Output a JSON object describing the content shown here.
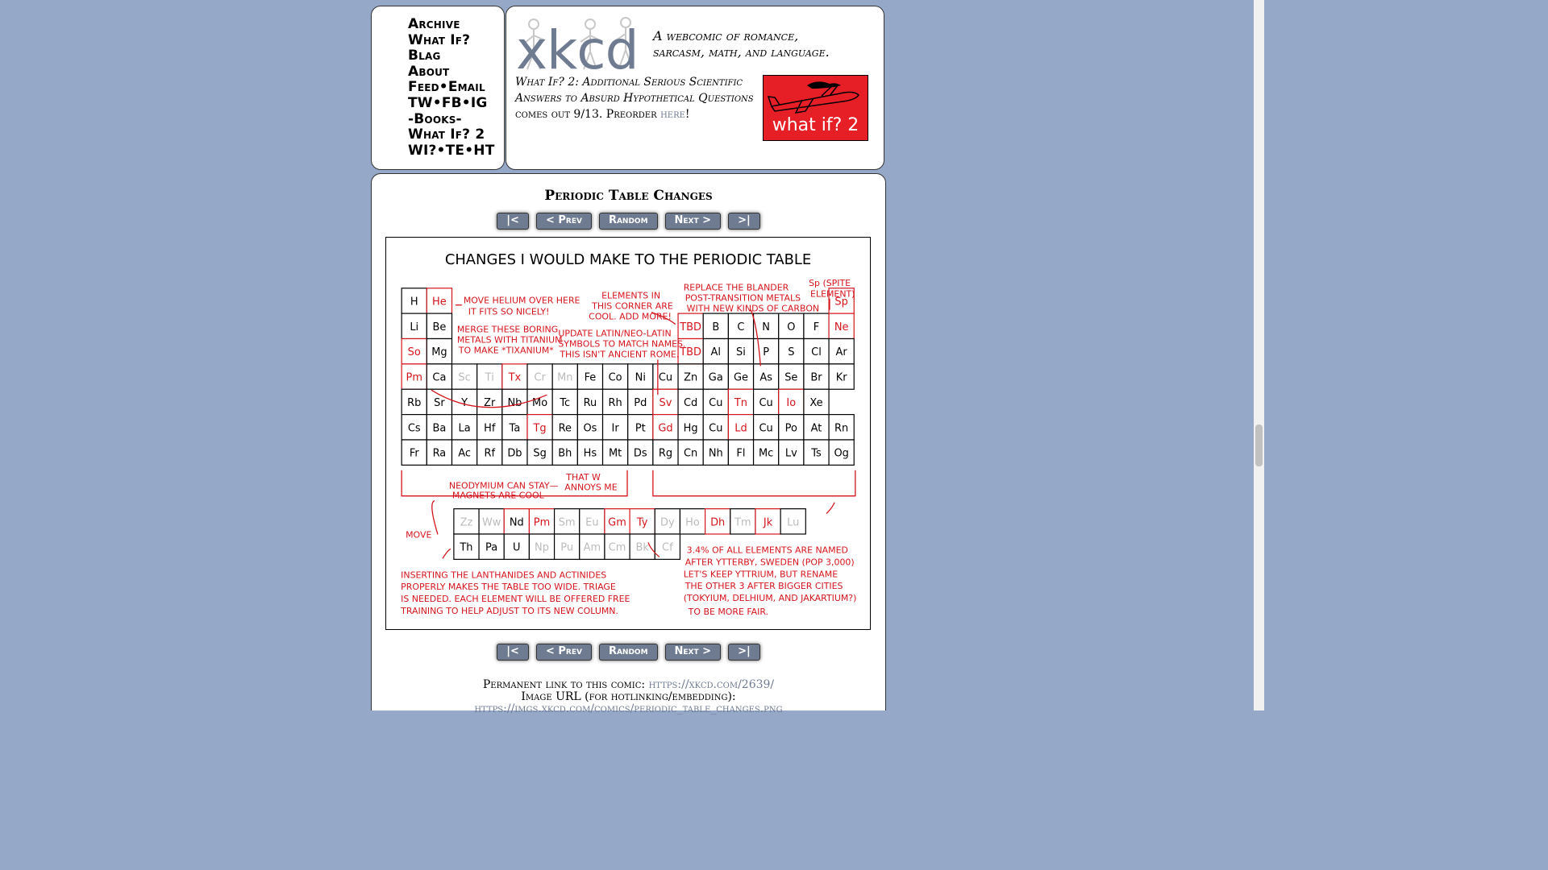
{
  "nav": {
    "items": [
      "Archive",
      "What If?",
      "Blag",
      "About",
      "Feed•Email",
      "TW•FB•IG",
      "-Books-",
      "What If? 2",
      "WI?•TE•HT"
    ]
  },
  "header": {
    "logo_text": "xkcd",
    "tagline_line1": "A webcomic of romance,",
    "tagline_line2": "sarcasm, math, and language.",
    "news_italic": "What If? 2: Additional Serious Scientific Answers to Absurd Hypothetical Questions",
    "news_rest": " comes out 9/13. Preorder ",
    "news_link": "here",
    "news_end": "!",
    "promo_label": "what if? 2"
  },
  "comic": {
    "title": "Periodic Table Changes",
    "buttons": {
      "first": "|<",
      "prev": "< Prev",
      "random": "Random",
      "next": "Next >",
      "last": ">|"
    },
    "panel_title": "CHANGES I WOULD MAKE TO THE PERIODIC TABLE",
    "table_rows": [
      [
        "H",
        "He",
        "",
        "",
        "",
        "",
        "",
        "",
        "",
        "",
        "",
        "",
        "",
        "",
        "",
        "",
        "",
        "Sp"
      ],
      [
        "Li",
        "Be",
        "",
        "",
        "",
        "",
        "",
        "",
        "",
        "",
        "",
        "",
        "TBD",
        "B",
        "C",
        "N",
        "O",
        "F",
        "Ne"
      ],
      [
        "So",
        "Mg",
        "",
        "",
        "",
        "",
        "",
        "",
        "",
        "",
        "",
        "",
        "TBD",
        "Al",
        "Si",
        "P",
        "S",
        "Cl",
        "Ar"
      ],
      [
        "Pm",
        "Ca",
        "Sc",
        "Ti",
        "Tx",
        "Cr",
        "Mn",
        "Fe",
        "Co",
        "Ni",
        "Cu",
        "Zn",
        "Ga",
        "Ge",
        "As",
        "Se",
        "Br",
        "Kr"
      ],
      [
        "Rb",
        "Sr",
        "Y",
        "Zr",
        "Nb",
        "Mo",
        "Tc",
        "Ru",
        "Rh",
        "Pd",
        "Sv",
        "Cd",
        "Cu",
        "Tn",
        "Cu",
        "Io",
        "Xe"
      ],
      [
        "Cs",
        "Ba",
        "La",
        "Hf",
        "Ta",
        "Tg",
        "Re",
        "Os",
        "Ir",
        "Pt",
        "Gd",
        "Hg",
        "Cu",
        "Ld",
        "Cu",
        "Po",
        "At",
        "Rn"
      ],
      [
        "Fr",
        "Ra",
        "Ac",
        "Rf",
        "Db",
        "Sg",
        "Bh",
        "Hs",
        "Mt",
        "Ds",
        "Rg",
        "Cn",
        "Nh",
        "Fl",
        "Mc",
        "Lv",
        "Ts",
        "Og"
      ]
    ],
    "lanthanides": [
      "Zz",
      "Ww",
      "Nd",
      "Pm",
      "Sm",
      "Eu",
      "Gm",
      "Ty",
      "Dy",
      "Ho",
      "Dh",
      "Tm",
      "Jk",
      "Lu"
    ],
    "actinides": [
      "Th",
      "Pa",
      "U",
      "Np",
      "Pu",
      "Am",
      "Cm",
      "Bk",
      "Cf"
    ],
    "notes": {
      "he": [
        "MOVE HELIUM OVER HERE",
        "IT FITS SO NICELY!"
      ],
      "corner": [
        "ELEMENTS IN",
        "THIS CORNER ARE",
        "COOL. ADD MORE!"
      ],
      "post": [
        "REPLACE THE BLANDER",
        "POST-TRANSITION METALS",
        "WITH NEW KINDS OF CARBON"
      ],
      "spite": [
        "Sp (SPITE",
        "ELEMENT)"
      ],
      "merge": [
        "MERGE THESE BORING",
        "METALS WITH TITANIUM",
        "TO MAKE *TIXANIUM*"
      ],
      "latin": [
        "UPDATE LATIN/NEO-LATIN",
        "SYMBOLS TO MATCH NAMES.",
        "THIS ISN'T ANCIENT ROME."
      ],
      "neo": [
        "NEODYMIUM CAN STAY—",
        "MAGNETS ARE COOL"
      ],
      "annoy": [
        "THAT W",
        "ANNOYS ME"
      ],
      "move": "MOVE",
      "insert": [
        "INSERTING THE LANTHANIDES AND ACTINIDES",
        "PROPERLY MAKES THE TABLE TOO WIDE. TRIAGE",
        "IS NEEDED. EACH ELEMENT WILL BE OFFERED FREE",
        "TRAINING TO HELP ADJUST TO ITS NEW COLUMN."
      ],
      "ytterby": [
        "3.4% OF ALL ELEMENTS ARE NAMED",
        "AFTER YTTERBY, SWEDEN (POP 3,000)",
        "LET'S KEEP YTTRIUM, BUT RENAME",
        "THE OTHER 3 AFTER BIGGER CITIES",
        "(TOKYIUM, DELHIUM, AND JAKARTIUM?)",
        "TO BE MORE FAIR."
      ]
    }
  },
  "footer": {
    "perm_label": "Permanent link to this comic: ",
    "perm_url": "https://xkcd.com/2639/",
    "img_label": "Image URL (for hotlinking/embedding): ",
    "img_url": "https://imgs.xkcd.com/comics/periodic_table_changes.png"
  },
  "colors": {
    "background": "#96a8c8",
    "link": "#6e7b91",
    "ink_red": "#d4141c",
    "promo_red": "#e61e26"
  }
}
